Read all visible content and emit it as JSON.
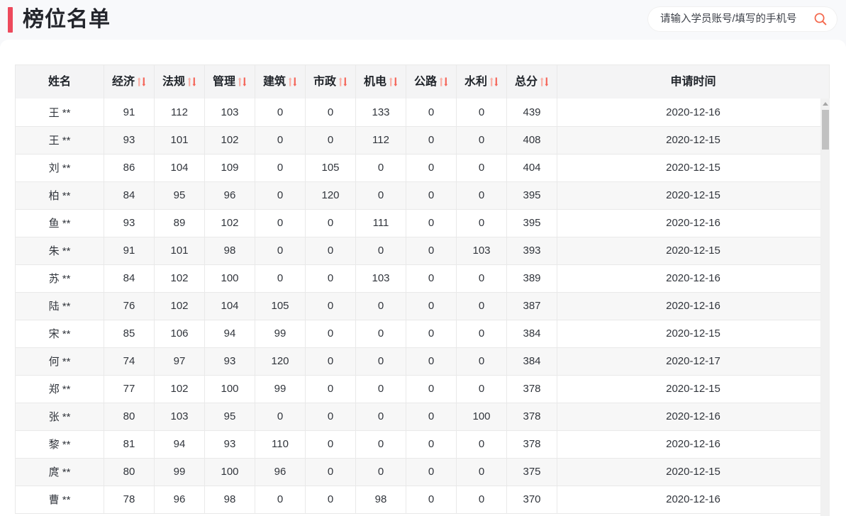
{
  "header": {
    "title": "榜位名单",
    "accent_color": "#ed4a5c"
  },
  "search": {
    "placeholder": "请输入学员账号/填写的手机号",
    "value": "",
    "icon": "search-icon",
    "icon_color": "#f4664a"
  },
  "table": {
    "sort_icon_color_up": "#fbb0a6",
    "sort_icon_color_down": "#f4665a",
    "columns": [
      {
        "label": "姓名",
        "sortable": false
      },
      {
        "label": "经济",
        "sortable": true
      },
      {
        "label": "法规",
        "sortable": true
      },
      {
        "label": "管理",
        "sortable": true
      },
      {
        "label": "建筑",
        "sortable": true
      },
      {
        "label": "市政",
        "sortable": true
      },
      {
        "label": "机电",
        "sortable": true
      },
      {
        "label": "公路",
        "sortable": true
      },
      {
        "label": "水利",
        "sortable": true
      },
      {
        "label": "总分",
        "sortable": true
      },
      {
        "label": "申请时间",
        "sortable": false
      }
    ],
    "rows": [
      {
        "name": "王 **",
        "jingji": "91",
        "fagui": "112",
        "guanli": "103",
        "jianzhu": "0",
        "shizheng": "0",
        "jidian": "133",
        "gonglu": "0",
        "shuili": "0",
        "zongfen": "439",
        "time": "2020-12-16"
      },
      {
        "name": "王 **",
        "jingji": "93",
        "fagui": "101",
        "guanli": "102",
        "jianzhu": "0",
        "shizheng": "0",
        "jidian": "112",
        "gonglu": "0",
        "shuili": "0",
        "zongfen": "408",
        "time": "2020-12-15"
      },
      {
        "name": "刘 **",
        "jingji": "86",
        "fagui": "104",
        "guanli": "109",
        "jianzhu": "0",
        "shizheng": "105",
        "jidian": "0",
        "gonglu": "0",
        "shuili": "0",
        "zongfen": "404",
        "time": "2020-12-15"
      },
      {
        "name": "柏 **",
        "jingji": "84",
        "fagui": "95",
        "guanli": "96",
        "jianzhu": "0",
        "shizheng": "120",
        "jidian": "0",
        "gonglu": "0",
        "shuili": "0",
        "zongfen": "395",
        "time": "2020-12-15"
      },
      {
        "name": "鱼 **",
        "jingji": "93",
        "fagui": "89",
        "guanli": "102",
        "jianzhu": "0",
        "shizheng": "0",
        "jidian": "111",
        "gonglu": "0",
        "shuili": "0",
        "zongfen": "395",
        "time": "2020-12-16"
      },
      {
        "name": "朱 **",
        "jingji": "91",
        "fagui": "101",
        "guanli": "98",
        "jianzhu": "0",
        "shizheng": "0",
        "jidian": "0",
        "gonglu": "0",
        "shuili": "103",
        "zongfen": "393",
        "time": "2020-12-15"
      },
      {
        "name": "苏 **",
        "jingji": "84",
        "fagui": "102",
        "guanli": "100",
        "jianzhu": "0",
        "shizheng": "0",
        "jidian": "103",
        "gonglu": "0",
        "shuili": "0",
        "zongfen": "389",
        "time": "2020-12-16"
      },
      {
        "name": "陆 **",
        "jingji": "76",
        "fagui": "102",
        "guanli": "104",
        "jianzhu": "105",
        "shizheng": "0",
        "jidian": "0",
        "gonglu": "0",
        "shuili": "0",
        "zongfen": "387",
        "time": "2020-12-16"
      },
      {
        "name": "宋 **",
        "jingji": "85",
        "fagui": "106",
        "guanli": "94",
        "jianzhu": "99",
        "shizheng": "0",
        "jidian": "0",
        "gonglu": "0",
        "shuili": "0",
        "zongfen": "384",
        "time": "2020-12-15"
      },
      {
        "name": "何 **",
        "jingji": "74",
        "fagui": "97",
        "guanli": "93",
        "jianzhu": "120",
        "shizheng": "0",
        "jidian": "0",
        "gonglu": "0",
        "shuili": "0",
        "zongfen": "384",
        "time": "2020-12-17"
      },
      {
        "name": "郑 **",
        "jingji": "77",
        "fagui": "102",
        "guanli": "100",
        "jianzhu": "99",
        "shizheng": "0",
        "jidian": "0",
        "gonglu": "0",
        "shuili": "0",
        "zongfen": "378",
        "time": "2020-12-15"
      },
      {
        "name": "张 **",
        "jingji": "80",
        "fagui": "103",
        "guanli": "95",
        "jianzhu": "0",
        "shizheng": "0",
        "jidian": "0",
        "gonglu": "0",
        "shuili": "100",
        "zongfen": "378",
        "time": "2020-12-16"
      },
      {
        "name": "黎 **",
        "jingji": "81",
        "fagui": "94",
        "guanli": "93",
        "jianzhu": "110",
        "shizheng": "0",
        "jidian": "0",
        "gonglu": "0",
        "shuili": "0",
        "zongfen": "378",
        "time": "2020-12-16"
      },
      {
        "name": "庹 **",
        "jingji": "80",
        "fagui": "99",
        "guanli": "100",
        "jianzhu": "96",
        "shizheng": "0",
        "jidian": "0",
        "gonglu": "0",
        "shuili": "0",
        "zongfen": "375",
        "time": "2020-12-15"
      },
      {
        "name": "曹 **",
        "jingji": "78",
        "fagui": "96",
        "guanli": "98",
        "jianzhu": "0",
        "shizheng": "0",
        "jidian": "98",
        "gonglu": "0",
        "shuili": "0",
        "zongfen": "370",
        "time": "2020-12-16"
      }
    ]
  }
}
